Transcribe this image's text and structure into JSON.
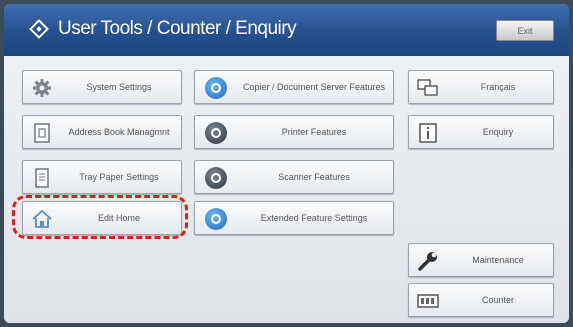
{
  "header": {
    "title": "User Tools / Counter / Enquiry",
    "exit_label": "Exit"
  },
  "buttons": {
    "system_settings": "System Settings",
    "copier_document_server": "Copier / Document Server Features",
    "language": "Français",
    "address_book": "Address Book Managmnt",
    "printer_features": "Printer Features",
    "inquiry": "Enquiry",
    "tray_paper_settings": "Tray Paper Settings",
    "scanner_features": "Scanner Features",
    "edit_home": "Edit Home",
    "extended_feature_settings": "Extended Feature Settings",
    "maintenance": "Maintenance",
    "counter": "Counter"
  },
  "colors": {
    "titlebar": "#25508f",
    "highlight": "#d0241f"
  }
}
